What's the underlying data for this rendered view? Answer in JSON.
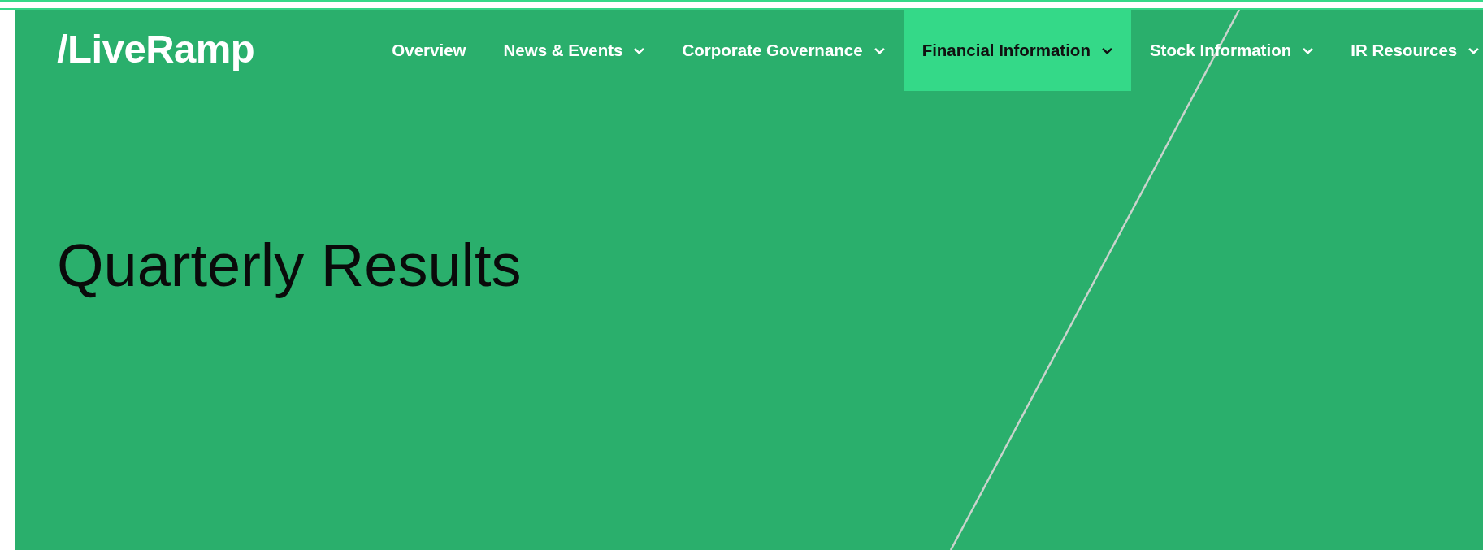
{
  "header": {
    "logo": "/LiveRamp",
    "nav": [
      {
        "label": "Overview",
        "dropdown": false,
        "selected": false
      },
      {
        "label": "News & Events",
        "dropdown": true,
        "selected": false
      },
      {
        "label": "Corporate Governance",
        "dropdown": true,
        "selected": false
      },
      {
        "label": "Financial Information",
        "dropdown": true,
        "selected": true
      },
      {
        "label": "Stock Information",
        "dropdown": true,
        "selected": false
      },
      {
        "label": "IR Resources",
        "dropdown": true,
        "selected": false
      }
    ]
  },
  "hero": {
    "title": "Quarterly Results"
  }
}
